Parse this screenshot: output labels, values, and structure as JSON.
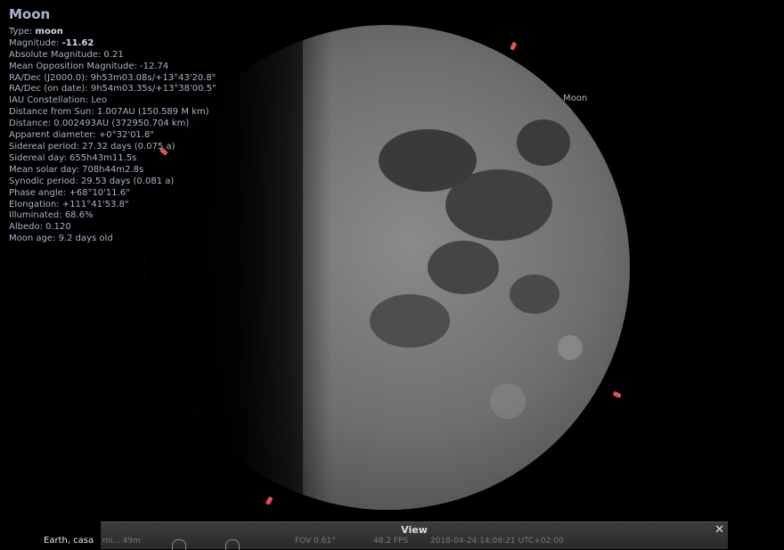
{
  "object": {
    "name": "Moon",
    "label": "Moon",
    "rows": [
      {
        "label": "Type: ",
        "value": "moon",
        "bold": true
      },
      {
        "label": "Magnitude: ",
        "value": "-11.62",
        "bold": true
      },
      {
        "label": "Absolute Magnitude: ",
        "value": "0.21"
      },
      {
        "label": "Mean Opposition Magnitude: ",
        "value": "-12.74"
      },
      {
        "label": "RA/Dec (J2000.0): ",
        "value": "9h53m03.08s/+13°43'20.8\""
      },
      {
        "label": "RA/Dec (on date): ",
        "value": "9h54m03.35s/+13°38'00.5\""
      },
      {
        "label": "IAU Constellation: ",
        "value": "Leo"
      },
      {
        "label": "Distance from Sun: ",
        "value": "1.007AU (150.589 M km)"
      },
      {
        "label": "Distance: ",
        "value": "0.002493AU (372950.704 km)"
      },
      {
        "label": "Apparent diameter: ",
        "value": "+0°32'01.8\""
      },
      {
        "label": "Sidereal period: ",
        "value": "27.32 days (0.075 a)"
      },
      {
        "label": "Sidereal day: ",
        "value": "655h43m11.5s"
      },
      {
        "label": "Mean solar day: ",
        "value": "708h44m2.8s"
      },
      {
        "label": "Synodic period: ",
        "value": "29.53 days (0.081 a)"
      },
      {
        "label": "Phase angle: ",
        "value": "+68°10'11.6\""
      },
      {
        "label": "Elongation: ",
        "value": "+111°41'53.8\""
      },
      {
        "label": "Illuminated: ",
        "value": "68.6%"
      },
      {
        "label": "Albedo: ",
        "value": "0.120"
      },
      {
        "label": "Moon age: ",
        "value": "9.2 days old"
      }
    ]
  },
  "location": "Earth, casa",
  "statusbar": {
    "title": "View",
    "close": "✕",
    "location_partial": "mi... 49m",
    "fov": "FOV 0.61°",
    "fps": "48.2 FPS",
    "datetime": "2018-04-24 14:08:21 UTC+02:00"
  },
  "colors": {
    "info_text": "#a8b4c8",
    "marker": "#e05050"
  }
}
